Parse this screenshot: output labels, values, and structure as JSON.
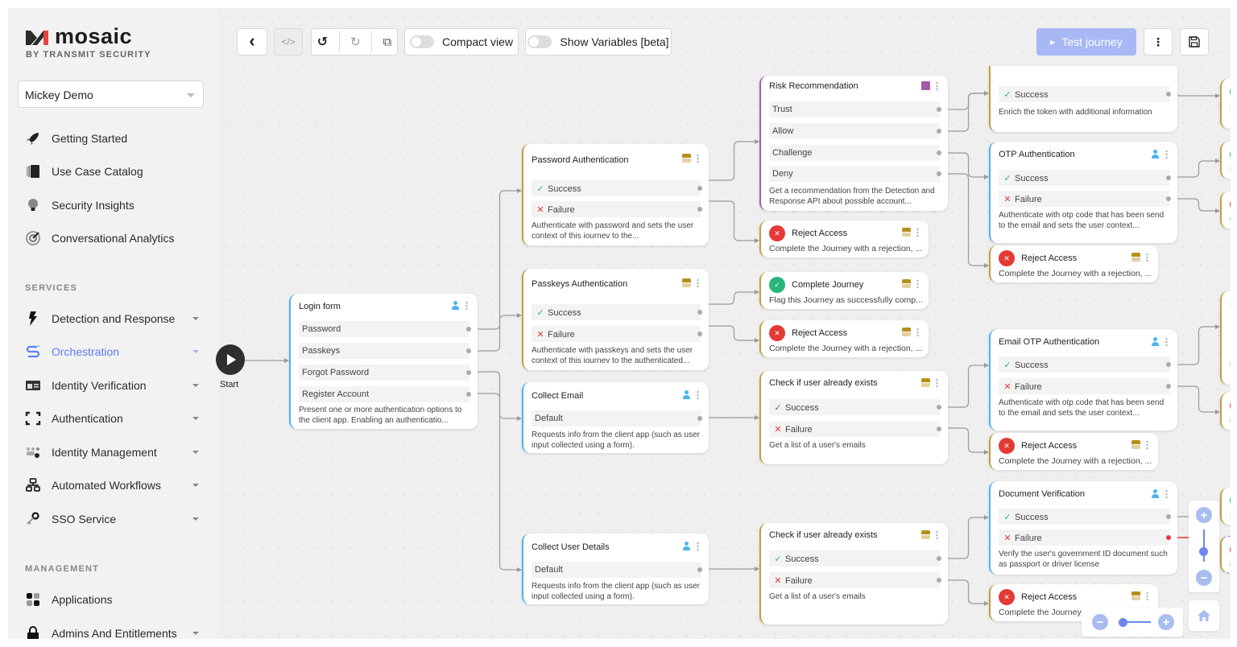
{
  "brand": {
    "name": "mosaic",
    "sub": "BY TRANSMIT SECURITY"
  },
  "tenant": {
    "value": "Mickey Demo"
  },
  "sidebar": {
    "top_items": [
      {
        "label": "Getting Started",
        "icon": "rocket-icon"
      },
      {
        "label": "Use Case Catalog",
        "icon": "catalog-icon"
      },
      {
        "label": "Security Insights",
        "icon": "lightbulb-icon"
      },
      {
        "label": "Conversational Analytics",
        "icon": "radar-icon"
      }
    ],
    "services_label": "SERVICES",
    "services": [
      {
        "label": "Detection and Response",
        "icon": "lightning-icon"
      },
      {
        "label": "Orchestration",
        "icon": "orchestration-icon",
        "active": true
      },
      {
        "label": "Identity Verification",
        "icon": "id-card-icon"
      },
      {
        "label": "Authentication",
        "icon": "scan-frame-icon"
      },
      {
        "label": "Identity Management",
        "icon": "users-gear-icon"
      },
      {
        "label": "Automated Workflows",
        "icon": "workflow-icon"
      },
      {
        "label": "SSO Service",
        "icon": "key-icon"
      }
    ],
    "management_label": "MANAGEMENT",
    "management": [
      {
        "label": "Applications",
        "icon": "apps-grid-icon"
      },
      {
        "label": "Admins And Entitlements",
        "icon": "lock-icon"
      }
    ]
  },
  "toolbar": {
    "back": "‹",
    "code": "</>",
    "undo": "↺",
    "redo": "↻",
    "copy": "⧉",
    "compact_view": "Compact view",
    "show_variables": "Show Variables [beta]",
    "test_journey": "Test journey",
    "more": "⋮",
    "save": "💾"
  },
  "start": {
    "label": "Start"
  },
  "nodes": {
    "login": {
      "title": "Login form",
      "outlets": [
        "Password",
        "Passkeys",
        "Forgot Password",
        "Register Account"
      ],
      "desc": "Present one or more authentication options to the client app. Enabling an authenticatio..."
    },
    "pwd": {
      "title": "Password Authentication",
      "outlets": [
        "Success",
        "Failure"
      ],
      "desc": "Authenticate with password and sets the user context of this iournev to the..."
    },
    "passkeys": {
      "title": "Passkeys Authentication",
      "outlets": [
        "Success",
        "Failure"
      ],
      "desc": "Authenticate with passkeys and sets the user context of this iournev to the authenticated..."
    },
    "collect_email": {
      "title": "Collect Email",
      "outlets": [
        "Default"
      ],
      "desc": "Requests info from the client app (such as user input collected using a form)."
    },
    "collect_user": {
      "title": "Collect User Details",
      "outlets": [
        "Default"
      ],
      "desc": "Requests info from the client app (such as user input collected using a form)."
    },
    "risk": {
      "title": "Risk Recommendation",
      "outlets": [
        "Trust",
        "Allow",
        "Challenge",
        "Deny"
      ],
      "desc": "Get a recommendation from the Detection and Response API about possible account..."
    },
    "check1": {
      "title": "Check if user already exists",
      "outlets": [
        "Success",
        "Failure"
      ],
      "desc": "Get a list of a user's emails"
    },
    "check2": {
      "title": "Check if user already exists",
      "outlets": [
        "Success",
        "Failure"
      ],
      "desc": "Get a list of a user's emails"
    },
    "enrich": {
      "outlets": [
        "Success"
      ],
      "desc": "Enrich the token with additional information"
    },
    "otp": {
      "title": "OTP Authentication",
      "outlets": [
        "Success",
        "Failure"
      ],
      "desc": "Authenticate with otp code that has been send to the email and sets the user context..."
    },
    "email_otp": {
      "title": "Email OTP Authentication",
      "outlets": [
        "Success",
        "Failure"
      ],
      "desc": "Authenticate with otp code that has been send to the email and sets the user context..."
    },
    "docver": {
      "title": "Document Verification",
      "outlets": [
        "Success",
        "Failure"
      ],
      "desc": "Verify the user's government ID document such as passport or driver license"
    }
  },
  "terminals": {
    "reject": {
      "title": "Reject Access",
      "desc": "Complete the Journey with a rejection, ..."
    },
    "complete": {
      "title": "Complete Journey",
      "desc": "Flag this Journey as successfully comp..."
    },
    "reject_trunc": "Complete the Journey",
    "edge_fl": "Fl",
    "edge_c": "C",
    "edge_re": "Re"
  }
}
